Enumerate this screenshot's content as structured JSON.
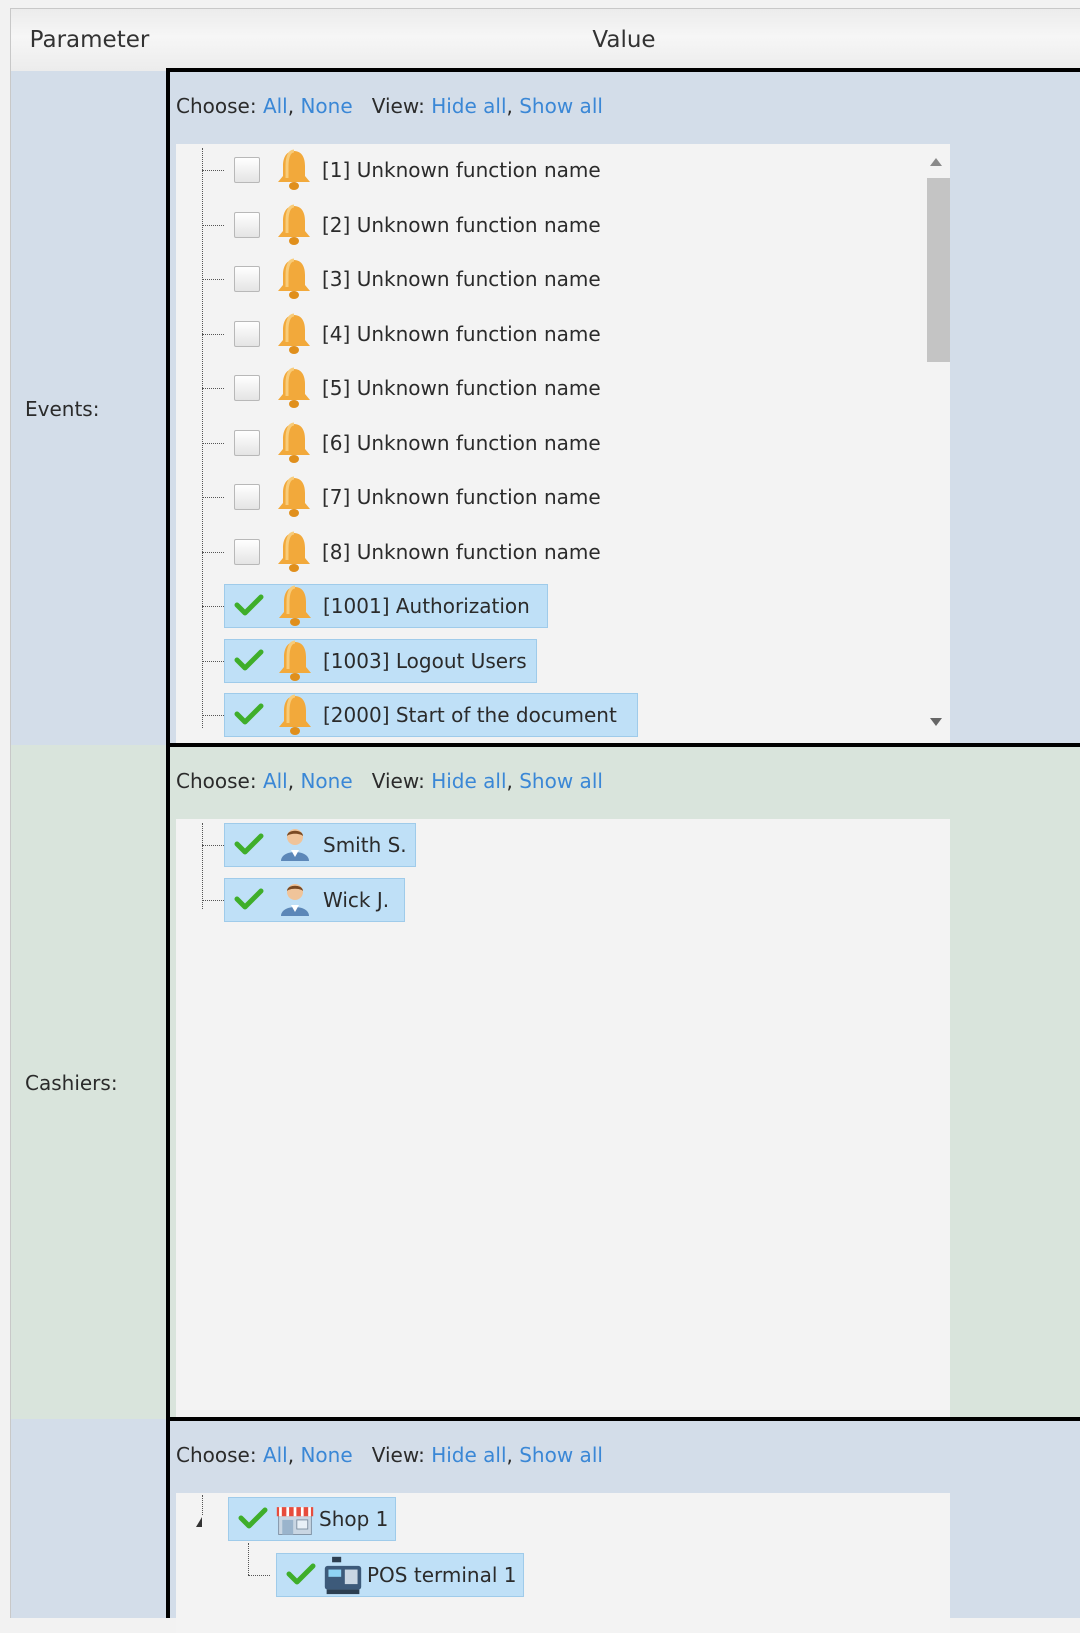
{
  "header": {
    "parameter": "Parameter",
    "value": "Value"
  },
  "toolbar": {
    "choose": "Choose:",
    "all": "All",
    "none": "None",
    "view": "View:",
    "hide_all": "Hide all",
    "show_all": "Show all",
    "sep": ","
  },
  "events": {
    "label": "Events:",
    "items": [
      {
        "text": "[1] Unknown function name",
        "checked": false
      },
      {
        "text": "[2] Unknown function name",
        "checked": false
      },
      {
        "text": "[3] Unknown function name",
        "checked": false
      },
      {
        "text": "[4] Unknown function name",
        "checked": false
      },
      {
        "text": "[5] Unknown function name",
        "checked": false
      },
      {
        "text": "[6] Unknown function name",
        "checked": false
      },
      {
        "text": "[7] Unknown function name",
        "checked": false
      },
      {
        "text": "[8] Unknown function name",
        "checked": false
      },
      {
        "text": "[1001] Authorization",
        "checked": true
      },
      {
        "text": "[1003] Logout Users",
        "checked": true
      },
      {
        "text": "[2000] Start of the document",
        "checked": true
      }
    ]
  },
  "cashiers": {
    "label": "Cashiers:",
    "items": [
      {
        "text": "Smith S.",
        "checked": true
      },
      {
        "text": "Wick J.",
        "checked": true
      }
    ]
  },
  "stores": {
    "items": [
      {
        "text": "Shop 1",
        "checked": true
      },
      {
        "text": "POS terminal 1",
        "checked": true
      }
    ]
  },
  "colors": {
    "link": "#3a87d6",
    "selected_bg": "#bfe0f7",
    "row_blue": "#d3dde9",
    "row_green": "#d9e4dc",
    "check_green": "#3fae2a",
    "bell": "#f2a93b"
  },
  "icons": {
    "event": "bell-icon",
    "cashier": "user-icon",
    "shop": "shop-icon",
    "terminal": "pos-terminal-icon"
  }
}
